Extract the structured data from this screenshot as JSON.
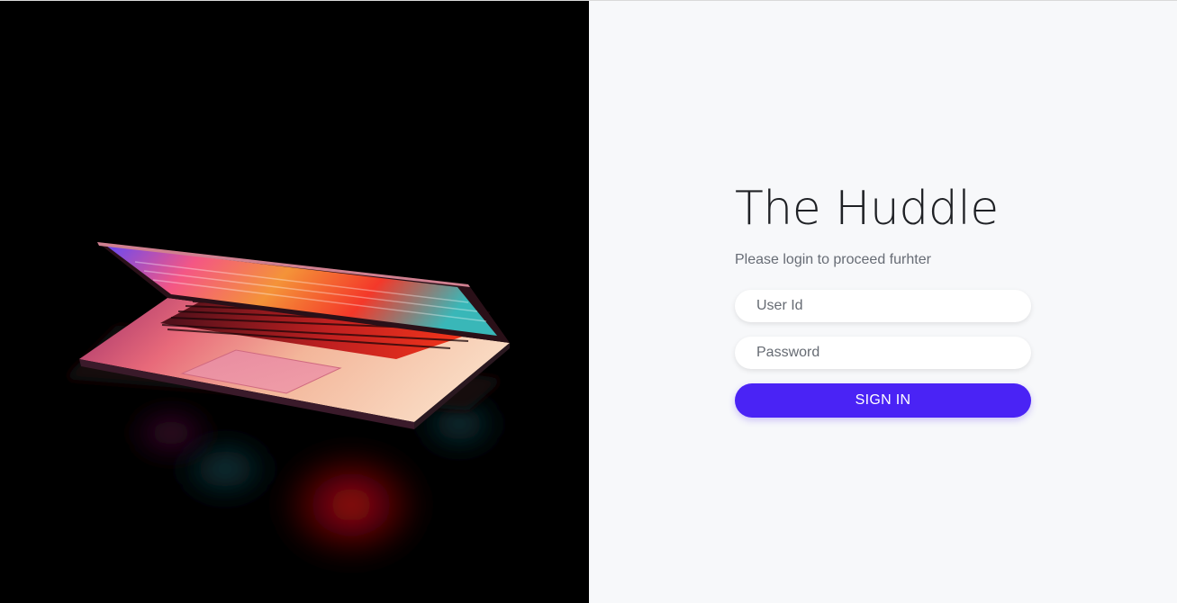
{
  "brand": {
    "title": "The Huddle",
    "subtitle": "Please login to proceed furhter"
  },
  "login": {
    "user_placeholder": "User Id",
    "password_placeholder": "Password",
    "submit_label": "SIGN IN"
  },
  "colors": {
    "accent": "#4a23f5",
    "panel_bg": "#f7f8fa",
    "hero_bg": "#000000"
  },
  "hero_image": {
    "icon": "laptop-photo"
  }
}
